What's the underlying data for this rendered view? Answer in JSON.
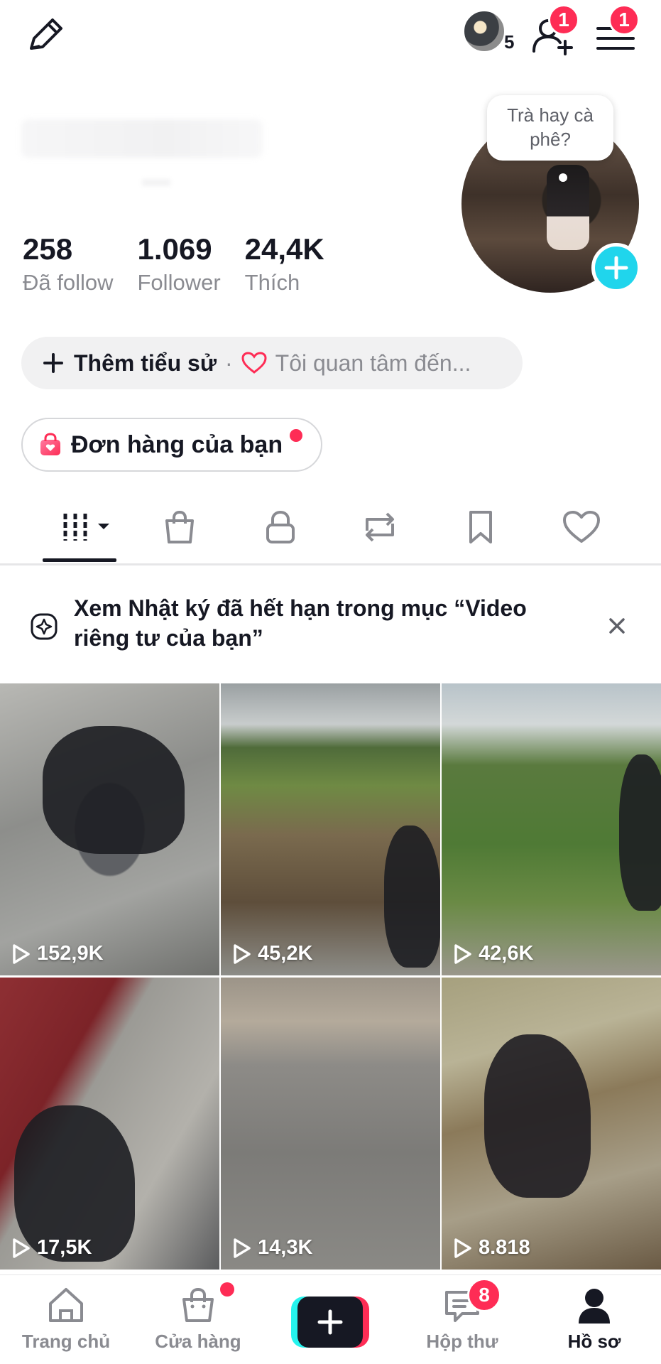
{
  "header": {
    "friends_count": "5",
    "add_friend_badge": "1",
    "menu_badge": "1"
  },
  "profile": {
    "avatar_note": "Trà hay cà phê?",
    "stats": [
      {
        "value": "258",
        "label": "Đã follow"
      },
      {
        "value": "1.069",
        "label": "Follower"
      },
      {
        "value": "24,4K",
        "label": "Thích"
      }
    ],
    "bio_add_label": "Thêm tiểu sử",
    "bio_separator": "·",
    "interest_label": "Tôi quan tâm đến...",
    "orders_label": "Đơn hàng của bạn"
  },
  "tabs": [
    {
      "name": "videos",
      "icon": "grid-icon",
      "active": true
    },
    {
      "name": "shop",
      "icon": "shopping-bag-icon",
      "active": false
    },
    {
      "name": "private",
      "icon": "lock-icon",
      "active": false
    },
    {
      "name": "reposts",
      "icon": "repost-icon",
      "active": false
    },
    {
      "name": "favorites",
      "icon": "bookmark-icon",
      "active": false
    },
    {
      "name": "liked",
      "icon": "heart-icon",
      "active": false
    }
  ],
  "banner": {
    "text": "Xem Nhật ký đã hết hạn trong mục “Video riêng tư của bạn”"
  },
  "videos": [
    {
      "views": "152,9K"
    },
    {
      "views": "45,2K"
    },
    {
      "views": "42,6K"
    },
    {
      "views": "17,5K"
    },
    {
      "views": "14,3K"
    },
    {
      "views": "8.818"
    }
  ],
  "bottom_nav": {
    "home": "Trang chủ",
    "shop": "Cửa hàng",
    "inbox": "Hộp thư",
    "inbox_badge": "8",
    "profile": "Hồ sơ"
  },
  "colors": {
    "accent_red": "#fe2c55",
    "accent_cyan": "#25f4ee",
    "add_button": "#20d5ec",
    "text_primary": "#161823",
    "text_secondary": "#8a8b91"
  }
}
